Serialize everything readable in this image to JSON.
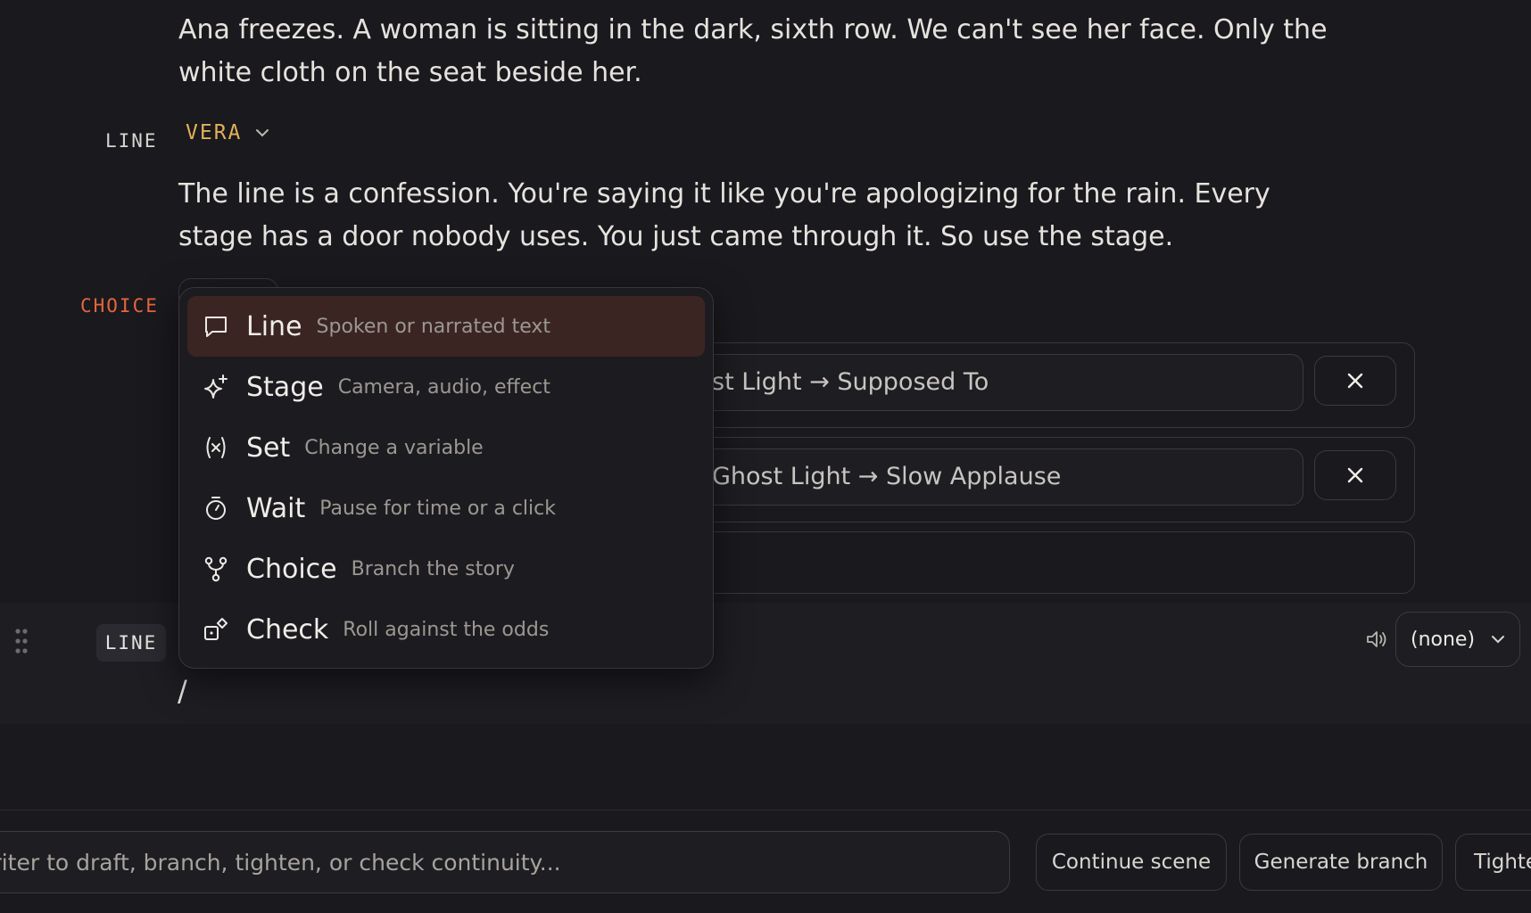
{
  "script": {
    "narration_text": "Ana freezes. A woman is sitting in the dark, sixth row. We can't see her face. Only the white cloth on the seat beside her.",
    "line_kind": "LINE",
    "character": "VERA",
    "line_text": "The line is a confession. You're saying it like you're apologizing for the rain. Every stage has a door nobody uses. You just came through it. So use the stage.",
    "choice_kind": "CHOICE",
    "choice_options": [
      {
        "target": "st Light → Supposed To",
        "remove_icon": "close-icon"
      },
      {
        "target": "Ghost Light → Slow Applause",
        "remove_icon": "close-icon"
      }
    ]
  },
  "active_block": {
    "kind": "LINE",
    "text": "/",
    "voice_value": "(none)"
  },
  "slash_menu": {
    "items": [
      {
        "label": "Line",
        "description": "Spoken or narrated text",
        "icon": "speech-bubble-icon"
      },
      {
        "label": "Stage",
        "description": "Camera, audio, effect",
        "icon": "sparkle-icon"
      },
      {
        "label": "Set",
        "description": "Change a variable",
        "icon": "variable-icon"
      },
      {
        "label": "Wait",
        "description": "Pause for time or a click",
        "icon": "timer-icon"
      },
      {
        "label": "Choice",
        "description": "Branch the story",
        "icon": "branch-icon"
      },
      {
        "label": "Check",
        "description": "Roll against the odds",
        "icon": "dice-icon"
      }
    ],
    "active_index": 0
  },
  "assistant": {
    "input_placeholder": "writer to draft, branch, tighten, or check continuity...",
    "actions": [
      "Continue scene",
      "Generate branch",
      "Tighte"
    ]
  },
  "colors": {
    "background": "#1a191d",
    "character_accent": "#e2b05a",
    "choice_accent": "#e5663f",
    "menu_active": "#3b2523"
  }
}
